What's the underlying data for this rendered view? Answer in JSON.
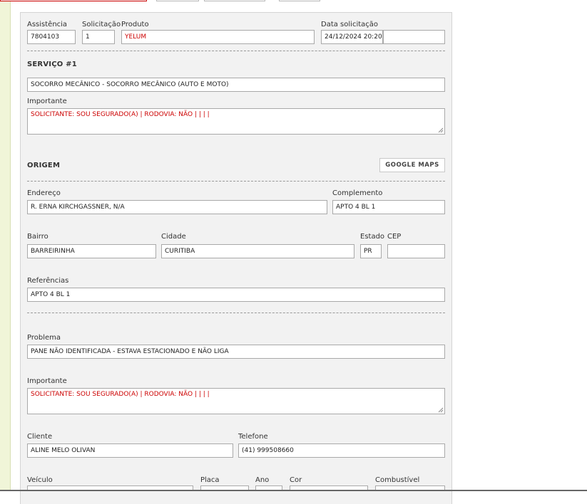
{
  "assistencia": {
    "label": "Assistência",
    "value": "7804103"
  },
  "solicitacao": {
    "label": "Solicitação",
    "value": "1"
  },
  "produto": {
    "label": "Produto",
    "value": "YELUM"
  },
  "data_solicitacao": {
    "label": "Data solicitação",
    "value": "24/12/2024 20:20",
    "extra": ""
  },
  "servico": {
    "title": "SERVIÇO #1",
    "description": "SOCORRO MECÂNICO - SOCORRO MECÂNICO (AUTO E MOTO)",
    "importante_label": "Importante",
    "importante_value": "SOLICITANTE: SOU SEGURADO(A) | RODOVIA: NÃO |  |  |  |"
  },
  "origem": {
    "title": "ORIGEM",
    "maps_button": "GOOGLE MAPS",
    "endereco": {
      "label": "Endereço",
      "value": "R. ERNA KIRCHGASSNER, N/A"
    },
    "complemento": {
      "label": "Complemento",
      "value": "APTO 4 BL 1"
    },
    "bairro": {
      "label": "Bairro",
      "value": "BARREIRINHA"
    },
    "cidade": {
      "label": "Cidade",
      "value": "CURITIBA"
    },
    "estado": {
      "label": "Estado",
      "value": "PR"
    },
    "cep": {
      "label": "CEP",
      "value": ""
    },
    "referencias": {
      "label": "Referências",
      "value": "APTO 4 BL 1"
    }
  },
  "problema": {
    "label": "Problema",
    "value": "PANE NÃO IDENTIFICADA - ESTAVA ESTACIONADO E NÃO LIGA"
  },
  "importante2": {
    "label": "Importante",
    "value": "SOLICITANTE: SOU SEGURADO(A) | RODOVIA: NÃO |  |  |  |"
  },
  "cliente": {
    "label": "Cliente",
    "value": "ALINE MELO OLIVAN"
  },
  "telefone": {
    "label": "Telefone",
    "value": "(41) 999508660"
  },
  "veiculo": {
    "label": "Veículo"
  },
  "placa": {
    "label": "Placa"
  },
  "ano": {
    "label": "Ano"
  },
  "cor": {
    "label": "Cor"
  },
  "combustivel": {
    "label": "Combustível"
  }
}
